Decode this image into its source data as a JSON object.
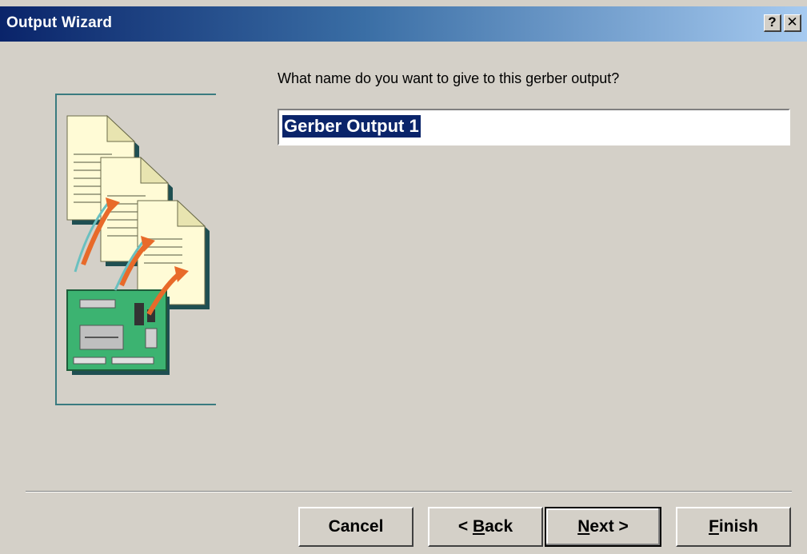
{
  "window": {
    "title": "Output Wizard",
    "help_label": "?",
    "close_label": "✕"
  },
  "main": {
    "prompt": "What name do you want to give to this gerber output?",
    "name_value": "Gerber Output 1"
  },
  "buttons": {
    "cancel": "Cancel",
    "back_prefix": "< ",
    "back_mnemonic": "B",
    "back_rest": "ack",
    "next_mnemonic": "N",
    "next_rest": "ext >",
    "finish_mnemonic": "F",
    "finish_rest": "inish"
  },
  "illustration": {
    "icon": "gerber-output-illustration-icon",
    "colors": {
      "frame": "#3a7b80",
      "paper": "#fffbd6",
      "board": "#3cb371",
      "arrow": "#e86a2a"
    }
  }
}
